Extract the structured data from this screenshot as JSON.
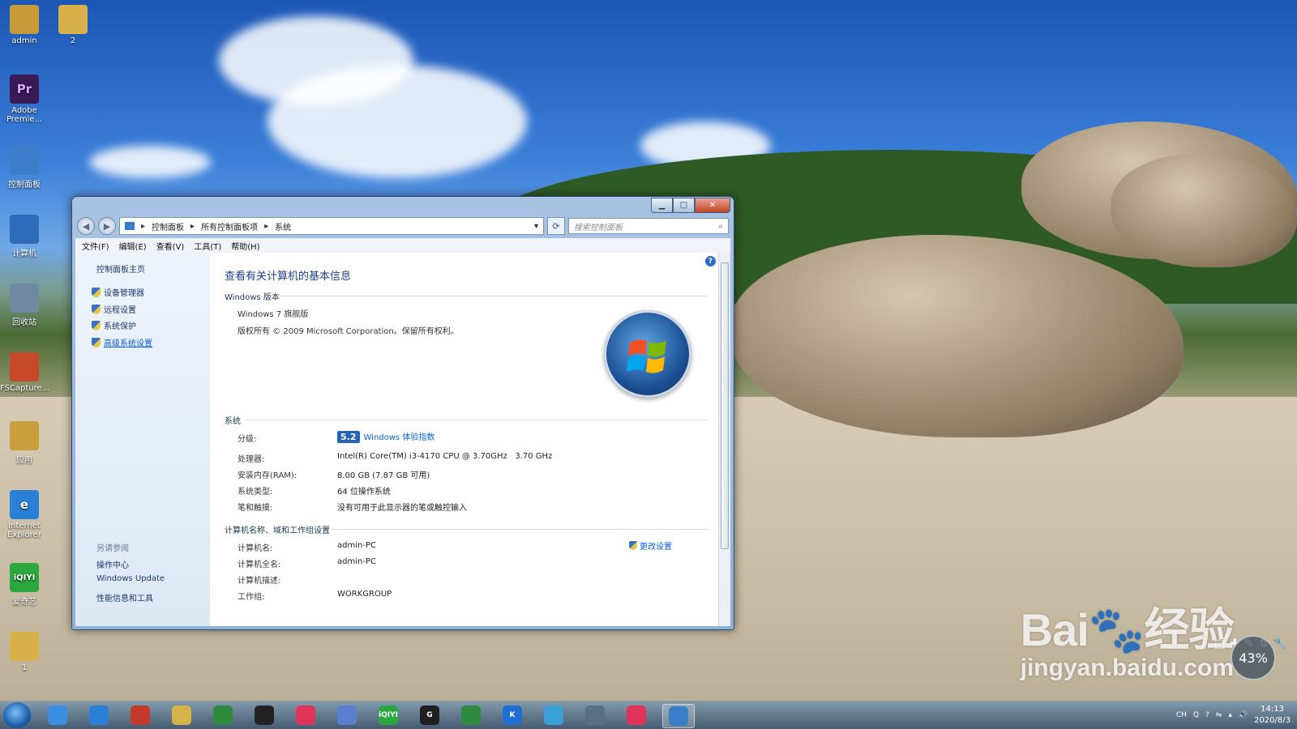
{
  "desktop": {
    "icons": [
      {
        "label": "admin",
        "color": "#c79a3a"
      },
      {
        "label": "2",
        "color": "#d7b04a"
      },
      {
        "label": "Adobe Premie...",
        "color": "#3a1a55",
        "text": "Pr"
      },
      {
        "label": "控制面板",
        "color": "#3a7ec9"
      },
      {
        "label": "计算机",
        "color": "#2e6bb8"
      },
      {
        "label": "回收站",
        "color": "#6f8aa0"
      },
      {
        "label": "FSCapture...",
        "color": "#c64a2a"
      },
      {
        "label": "应用",
        "color": "#c7a03d"
      },
      {
        "label": "Internet Explorer",
        "color": "#2a7fd6"
      },
      {
        "label": "爱奇艺",
        "color": "#2aa83d",
        "text": "iQIYI"
      },
      {
        "label": "1",
        "color": "#d7b04a"
      }
    ]
  },
  "window": {
    "breadcrumbs": [
      "控制面板",
      "所有控制面板项",
      "系统"
    ],
    "search_placeholder": "搜索控制面板",
    "menu": [
      "文件(F)",
      "编辑(E)",
      "查看(V)",
      "工具(T)",
      "帮助(H)"
    ],
    "sidebar": {
      "home": "控制面板主页",
      "links": [
        "设备管理器",
        "远程设置",
        "系统保护",
        "高级系统设置"
      ],
      "see_also_heading": "另请参阅",
      "see_also": [
        "操作中心",
        "Windows Update",
        "性能信息和工具"
      ]
    },
    "main": {
      "title": "查看有关计算机的基本信息",
      "edition_heading": "Windows 版本",
      "edition": "Windows 7 旗舰版",
      "copyright": "版权所有 © 2009 Microsoft Corporation。保留所有权利。",
      "system_heading": "系统",
      "rating_label": "分级:",
      "rating_score": "5.2",
      "rating_link": "Windows 体验指数",
      "cpu_label": "处理器:",
      "cpu_value": "Intel(R) Core(TM) i3-4170 CPU @ 3.70GHz   3.70 GHz",
      "ram_label": "安装内存(RAM):",
      "ram_value": "8.00 GB (7.87 GB 可用)",
      "type_label": "系统类型:",
      "type_value": "64 位操作系统",
      "pen_label": "笔和触摸:",
      "pen_value": "没有可用于此显示器的笔或触控输入",
      "name_heading": "计算机名称、域和工作组设置",
      "change_settings": "更改设置",
      "pcname_label": "计算机名:",
      "pcname_value": "admin-PC",
      "fullname_label": "计算机全名:",
      "fullname_value": "admin-PC",
      "desc_label": "计算机描述:",
      "workgroup_label": "工作组:",
      "workgroup_value": "WORKGROUP"
    }
  },
  "taskbar": {
    "icons": [
      {
        "name": "baidu-netdisk",
        "color": "#3a8fe0"
      },
      {
        "name": "ie",
        "color": "#2a7fd6"
      },
      {
        "name": "app-red",
        "color": "#c23a2a"
      },
      {
        "name": "explorer",
        "color": "#d6b24a"
      },
      {
        "name": "excel-green",
        "color": "#2e8b3d"
      },
      {
        "name": "qq",
        "color": "#222222"
      },
      {
        "name": "youku",
        "color": "#e0335a"
      },
      {
        "name": "feige",
        "color": "#5a7fd0"
      },
      {
        "name": "iqiyi",
        "color": "#2aa83d",
        "text": "iQIYI"
      },
      {
        "name": "g-app",
        "color": "#1f1f1f",
        "text": "G"
      },
      {
        "name": "green-app",
        "color": "#2e8b3d"
      },
      {
        "name": "kugou",
        "color": "#1e6fd0",
        "text": "K"
      },
      {
        "name": "player",
        "color": "#3aa0d8"
      },
      {
        "name": "browser",
        "color": "#5a6f86"
      },
      {
        "name": "youku-2",
        "color": "#e0335a"
      },
      {
        "name": "control-panel",
        "color": "#3a7ec9"
      }
    ],
    "tray_lang": "CH",
    "time": "14:13",
    "date": "2020/8/3"
  },
  "overlay": {
    "watermark_top": "Bai",
    "watermark_mid": "经验",
    "watermark_url": "jingyan.baidu.com",
    "speed_percent": "43%"
  }
}
